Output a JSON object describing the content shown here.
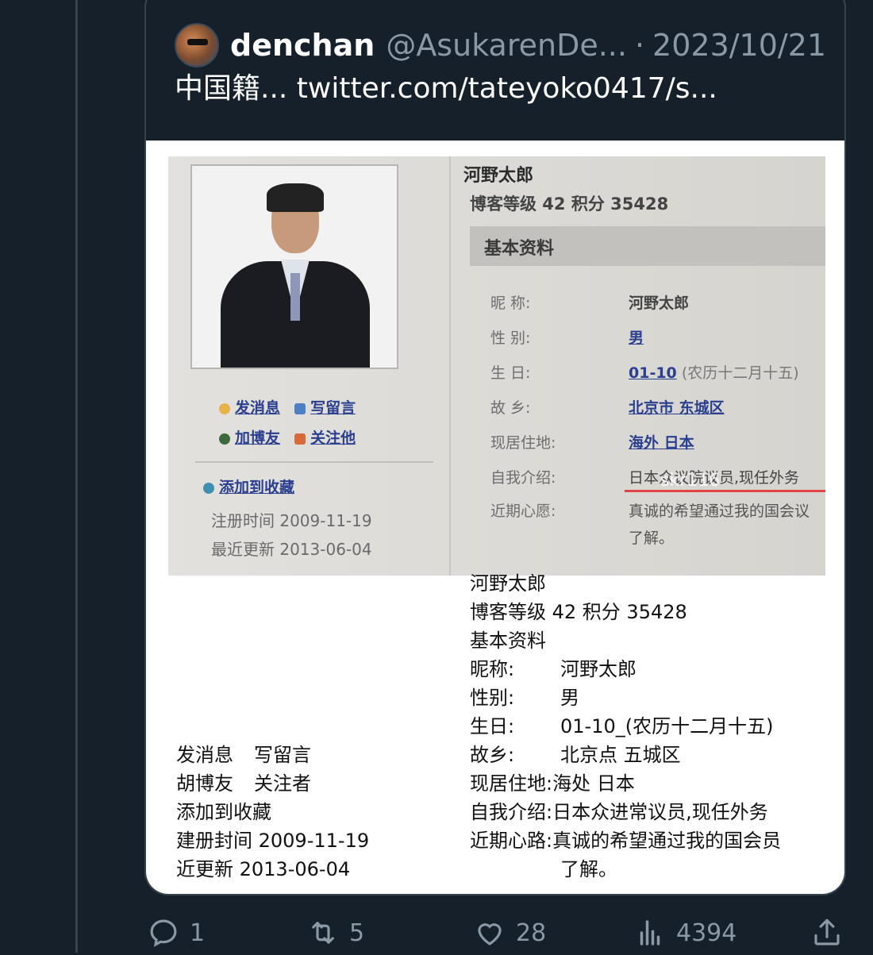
{
  "quote": {
    "display_name": "denchan",
    "handle": "@AsukarenDe...",
    "separator": "·",
    "date": "2023/10/21",
    "text": "中国籍... twitter.com/tateyoko0417/s..."
  },
  "photo": {
    "name": "河野太郎",
    "level_line": "博客等级 42 积分 35428",
    "section": "基本资料",
    "fields": [
      {
        "label": "昵    称:",
        "value": "河野太郎"
      },
      {
        "label": "性    别:",
        "value": "男"
      },
      {
        "label": "生    日:",
        "value": "01-10",
        "extra": "(农历十二月十五)"
      },
      {
        "label": "故    乡:",
        "value": "北京市  东城区"
      },
      {
        "label": "现居住地:",
        "value": "海外  日本"
      },
      {
        "label": "自我介绍:",
        "value": "日本众议院议员,现任外务"
      },
      {
        "label": "近期心愿:",
        "value": "真诚的希望通过我的国会议",
        "value2": "了解。"
      }
    ],
    "links": [
      "发消息",
      "写留言",
      "加博友",
      "关注他",
      "添加到收藏"
    ],
    "registered": "注册时间 2009-11-19",
    "updated": "最近更新 2013-06-04",
    "watermark": "skr116"
  },
  "transcript": {
    "left": {
      "line1": [
        "发消息",
        "写留言"
      ],
      "line2": [
        "胡博友",
        "关注者"
      ],
      "line3": "添加到收藏",
      "line4": "建册封间 2009-11-19",
      "line5": "近更新 2013-06-04"
    },
    "right": {
      "name": "河野太郎",
      "level": "博客等级 42 积分 35428",
      "section": "基本资料",
      "rows": [
        {
          "k": "昵称:",
          "v": "河野太郎"
        },
        {
          "k": "性别:",
          "v": "男"
        },
        {
          "k": "生日:",
          "v": "01-10_(农历十二月十五)"
        },
        {
          "k": "故乡:",
          "v": "北京点 五城区"
        },
        {
          "k": "现居住地:",
          "v": "海处 日本"
        },
        {
          "k": "自我介绍:",
          "v": "日本众进常议员,现任外务"
        },
        {
          "k": "近期心路:",
          "v": "真诚的希望通过我的国会员"
        }
      ],
      "tail": "了解。"
    }
  },
  "actions": {
    "replies": "1",
    "retweets": "5",
    "likes": "28",
    "views": "4394"
  },
  "colors": {
    "background": "#15202b",
    "border": "#38444d",
    "muted": "#8b98a5"
  }
}
